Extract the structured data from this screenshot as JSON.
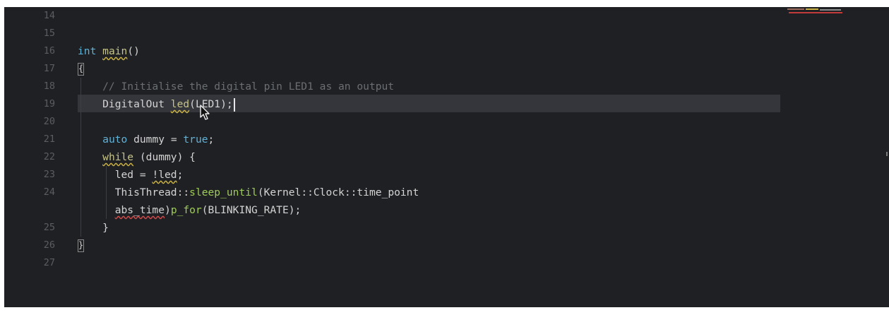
{
  "editor": {
    "lines": [
      {
        "num": "14",
        "tokens": []
      },
      {
        "num": "15",
        "tokens": []
      },
      {
        "num": "16",
        "tokens": [
          {
            "t": "int",
            "c": "kw"
          },
          {
            "t": " ",
            "c": "plain"
          },
          {
            "t": "main",
            "c": "fn squiggle-y"
          },
          {
            "t": "()",
            "c": "plain"
          }
        ]
      },
      {
        "num": "17",
        "tokens": [
          {
            "t": "{",
            "c": "bracket"
          }
        ]
      },
      {
        "num": "18",
        "tokens": [
          {
            "t": "    // Initialise the digital pin LED1 as an output",
            "c": "comment"
          }
        ]
      },
      {
        "num": "19",
        "tokens": [
          {
            "t": "    DigitalOut ",
            "c": "plain"
          },
          {
            "t": "led",
            "c": "fn squiggle-y"
          },
          {
            "t": "(LED1);",
            "c": "plain"
          }
        ]
      },
      {
        "num": "20",
        "tokens": []
      },
      {
        "num": "21",
        "tokens": [
          {
            "t": "    ",
            "c": "plain"
          },
          {
            "t": "auto",
            "c": "kw"
          },
          {
            "t": " dummy = ",
            "c": "plain"
          },
          {
            "t": "true",
            "c": "kw"
          },
          {
            "t": ";",
            "c": "plain"
          }
        ]
      },
      {
        "num": "22",
        "tokens": [
          {
            "t": "    ",
            "c": "plain"
          },
          {
            "t": "while",
            "c": "fn squiggle-y"
          },
          {
            "t": " (dummy) {",
            "c": "plain"
          }
        ]
      },
      {
        "num": "23",
        "tokens": [
          {
            "t": "      led = ",
            "c": "plain"
          },
          {
            "t": "!led",
            "c": "plain squiggle-y"
          },
          {
            "t": ";",
            "c": "plain"
          }
        ]
      },
      {
        "num": "24",
        "tokens": [
          {
            "t": "      ThisThread::",
            "c": "plain"
          },
          {
            "t": "sleep_until",
            "c": "fn2"
          },
          {
            "t": "(Kernel::Clock::time_point",
            "c": "plain"
          }
        ]
      },
      {
        "num": "",
        "tokens": [
          {
            "t": "      ",
            "c": "plain"
          },
          {
            "t": "abs_time",
            "c": "plain squiggle-r"
          },
          {
            "t": ")",
            "c": "plain"
          },
          {
            "t": "p_for",
            "c": "fn2"
          },
          {
            "t": "(BLINKING_RATE);",
            "c": "plain"
          }
        ]
      },
      {
        "num": "25",
        "tokens": [
          {
            "t": "    }",
            "c": "plain"
          }
        ]
      },
      {
        "num": "26",
        "tokens": [
          {
            "t": "}",
            "c": "bracket"
          }
        ]
      },
      {
        "num": "27",
        "tokens": []
      }
    ]
  },
  "colors": {
    "background": "#1f2023",
    "keyword": "#5fb2d8",
    "function": "#c6c48a",
    "method": "#9fcb5a",
    "comment": "#6b6e72",
    "line_number": "#5a5d61",
    "current_line": "#34363b"
  },
  "icons": {
    "mouse_cursor": "arrow-pointer-icon",
    "text_cursor": "text-caret"
  }
}
